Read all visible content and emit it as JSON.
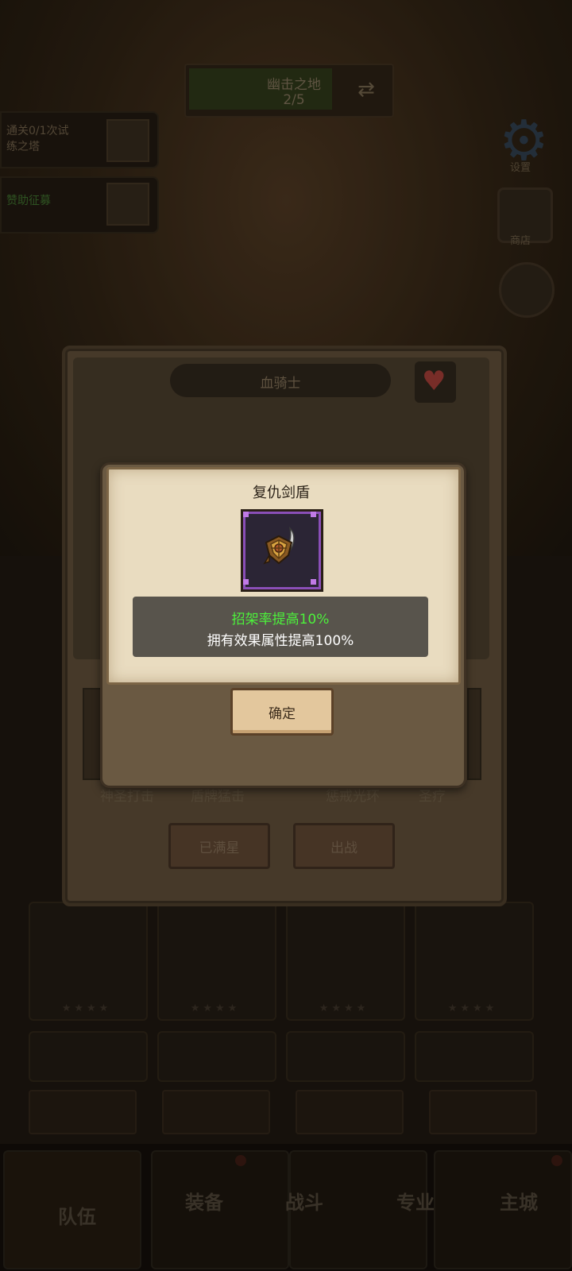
{
  "background": {
    "stage": {
      "name": "幽击之地",
      "progress": "2/5"
    },
    "quests": [
      {
        "line1": "通关0/1次试",
        "line2": "练之塔"
      },
      {
        "line1": "赞助征募",
        "line2": ""
      }
    ],
    "side_buttons": {
      "settings_label": "设置",
      "shop_label": "商店"
    },
    "hero": {
      "name": "血骑士"
    },
    "skills": [
      "神圣打击",
      "盾牌猛击",
      "惩戒光环",
      "圣疗"
    ],
    "buttons": {
      "max_star": "已满星",
      "deploy": "出战"
    },
    "bottom_nav": [
      "队伍",
      "装备",
      "战斗",
      "专业",
      "主城"
    ]
  },
  "popup": {
    "title": "复仇剑盾",
    "item_icon": "sword-shield-icon",
    "effect_main": "招架率提高10%",
    "effect_owned": "拥有效果属性提高100%",
    "confirm_label": "确定",
    "accent_green": "#4cf23b",
    "rarity_color": "#8a4fb8"
  }
}
